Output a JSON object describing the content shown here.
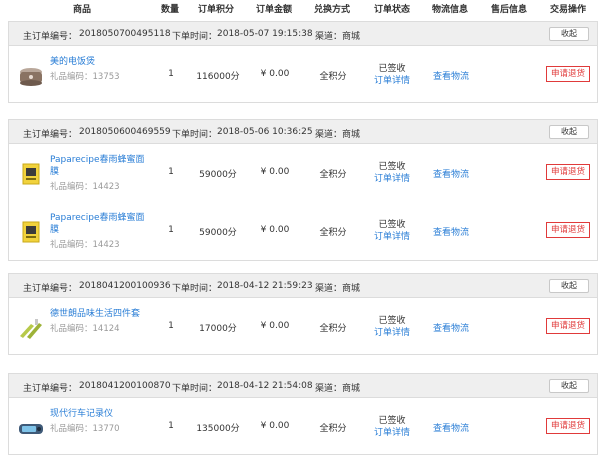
{
  "columns": [
    "商品",
    "数量",
    "订单积分",
    "订单金额",
    "兑换方式",
    "订单状态",
    "物流信息",
    "售后信息",
    "交易操作"
  ],
  "labels": {
    "order_no": "主订单编号：",
    "order_time": "下单时间：",
    "channel": "渠道：",
    "collapse": "收起",
    "code_prefix": "礼品编码：",
    "status_detail": "订单详情",
    "logistics": "查看物流",
    "refund": "申请退货"
  },
  "orders": [
    {
      "order_no": "2018050700495118",
      "time": "2018-05-07 19:15:38",
      "channel": "商城",
      "items": [
        {
          "name": "美的电饭煲",
          "code": "13753",
          "qty": "1",
          "points": "116000分",
          "amount": "¥ 0.00",
          "method": "全积分",
          "status": "已签收",
          "icon": "rice-cooker-icon"
        }
      ]
    },
    {
      "order_no": "2018050600469559",
      "time": "2018-05-06 10:36:25",
      "channel": "商城",
      "items": [
        {
          "name": "Paparecipe春雨蜂蜜面膜",
          "code": "14423",
          "qty": "1",
          "points": "59000分",
          "amount": "¥ 0.00",
          "method": "全积分",
          "status": "已签收",
          "icon": "face-mask-icon"
        },
        {
          "name": "Paparecipe春雨蜂蜜面膜",
          "code": "14423",
          "qty": "1",
          "points": "59000分",
          "amount": "¥ 0.00",
          "method": "全积分",
          "status": "已签收",
          "icon": "face-mask-icon"
        }
      ]
    },
    {
      "order_no": "2018041200100936",
      "time": "2018-04-12 21:59:23",
      "channel": "商城",
      "items": [
        {
          "name": "德世朗品味生活四件套",
          "code": "14124",
          "qty": "1",
          "points": "17000分",
          "amount": "¥ 0.00",
          "method": "全积分",
          "status": "已签收",
          "icon": "kitchen-set-icon"
        }
      ]
    },
    {
      "order_no": "2018041200100870",
      "time": "2018-04-12 21:54:08",
      "channel": "商城",
      "items": [
        {
          "name": "现代行车记录仪",
          "code": "13770",
          "qty": "1",
          "points": "135000分",
          "amount": "¥ 0.00",
          "method": "全积分",
          "status": "已签收",
          "icon": "dashcam-icon"
        }
      ]
    }
  ]
}
